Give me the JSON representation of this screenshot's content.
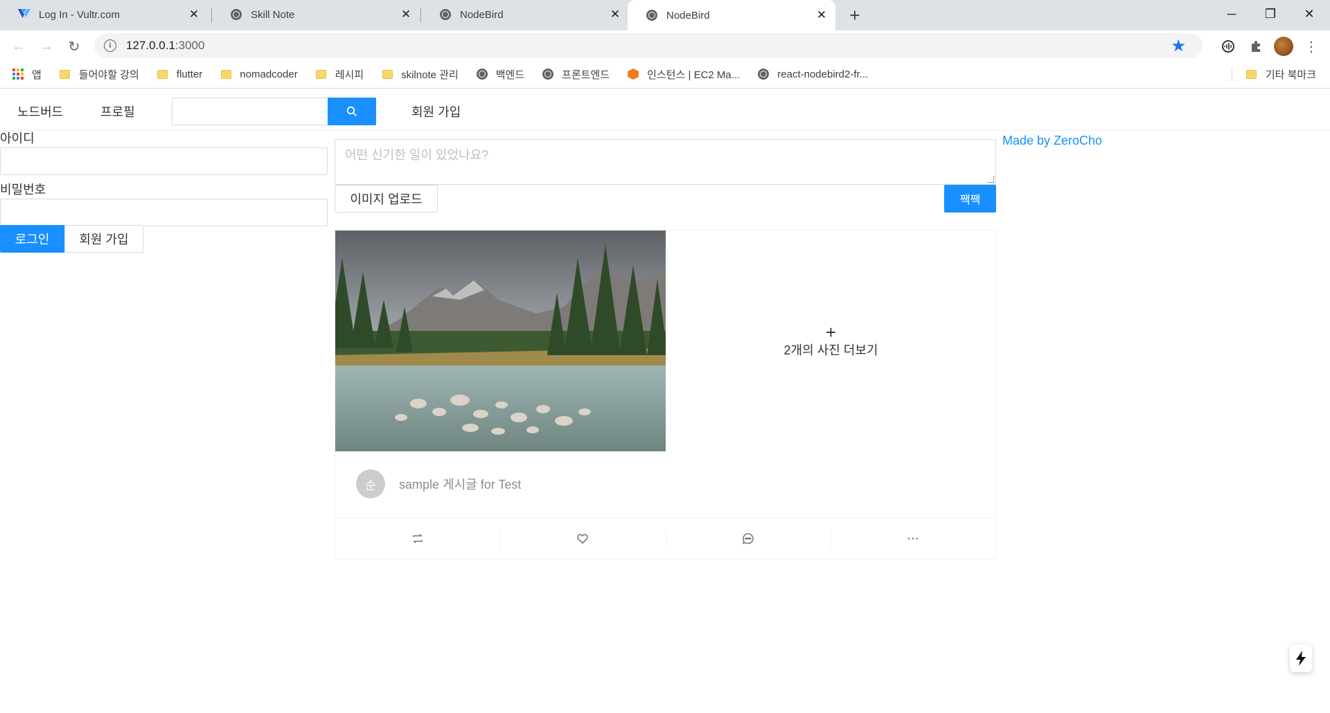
{
  "browser": {
    "tabs": [
      {
        "title": "Log In - Vultr.com",
        "icon": "vultr-logo-icon",
        "active": false
      },
      {
        "title": "Skill Note",
        "icon": "globe-icon",
        "active": false
      },
      {
        "title": "NodeBird",
        "icon": "globe-icon",
        "active": false
      },
      {
        "title": "NodeBird",
        "icon": "globe-icon",
        "active": true
      }
    ],
    "url_host": "127.0.0.1",
    "url_port": ":3000",
    "bookmarks": [
      {
        "label": "앱",
        "icon": "apps-grid-icon"
      },
      {
        "label": "들어야할 강의",
        "icon": "folder-icon"
      },
      {
        "label": "flutter",
        "icon": "folder-icon"
      },
      {
        "label": "nomadcoder",
        "icon": "folder-icon"
      },
      {
        "label": "레시피",
        "icon": "folder-icon"
      },
      {
        "label": "skilnote 관리",
        "icon": "folder-icon"
      },
      {
        "label": "백엔드",
        "icon": "globe-icon"
      },
      {
        "label": "프론트엔드",
        "icon": "globe-icon"
      },
      {
        "label": "인스턴스 | EC2 Ma...",
        "icon": "aws-icon"
      },
      {
        "label": "react-nodebird2-fr...",
        "icon": "globe-icon"
      }
    ],
    "other_bookmarks": "기타 북마크",
    "accent_color": "#1a73e8"
  },
  "app": {
    "menu": {
      "home": "노드버드",
      "profile": "프로필",
      "search_value": "",
      "signup": "회원 가입"
    },
    "login": {
      "id_label": "아이디",
      "id_value": "",
      "password_label": "비밀번호",
      "password_value": "",
      "login_button": "로그인",
      "signup_button": "회원 가입"
    },
    "post_form": {
      "placeholder": "어떤 신기한 일이 있었나요?",
      "upload_button": "이미지 업로드",
      "submit_button": "짹짹"
    },
    "post": {
      "more_photos": "2개의 사진 더보기",
      "avatar_initial": "순",
      "content": "sample 게시글 for Test",
      "actions": [
        "retweet-icon",
        "heart-icon",
        "message-icon",
        "ellipsis-icon"
      ]
    },
    "footer_link": "Made by ZeroCho",
    "primary_color": "#1890ff"
  }
}
